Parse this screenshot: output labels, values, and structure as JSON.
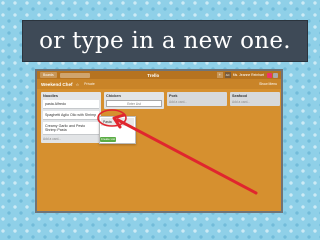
{
  "banner": {
    "text": "or type in a new one."
  },
  "topbar": {
    "boards_label": "Boards",
    "logo_label": "Trello",
    "avatar_initials": "AC",
    "user_name": "Ms. Jeanne Reinhart"
  },
  "board": {
    "title": "Weekend Chef",
    "privacy_label": "Private",
    "menu_label": "Show Menu"
  },
  "lists": [
    {
      "title": "Noodles",
      "cards": [
        {
          "title": "pasta Alfredo"
        },
        {
          "title": "Spaghetti Aglio Olio with Shrimp"
        },
        {
          "title": "Creamy Garlic and Pesto Shrimp Pasta"
        }
      ],
      "add_label": "Add a card..."
    },
    {
      "title": "Chicken",
      "input_placeholder": "Enter List",
      "add_label": ""
    },
    {
      "title": "Pork",
      "add_label": "Add a card..."
    },
    {
      "title": "Seafood",
      "add_label": "Add a card..."
    }
  ],
  "dropdown": {
    "option_label": "Pasta",
    "create_label": "Create List"
  },
  "colors": {
    "board_bg": "#d6902f",
    "arrow": "#e0262e",
    "banner_bg": "#3e4a57",
    "button_green": "#5aac44"
  }
}
